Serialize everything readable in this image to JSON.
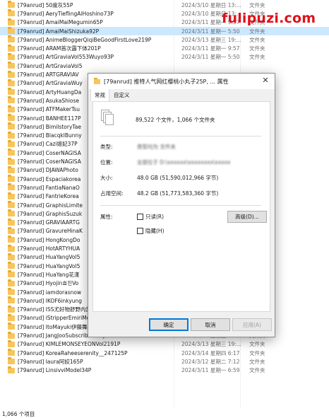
{
  "watermark": "fulipuzi.com",
  "rows": [
    {
      "name": "[79anrud] 50度灰55P",
      "date": "2024/3/10 星期日 13:...",
      "type": "文件夹"
    },
    {
      "name": "[79anrud] AeryTieflingAiHoshino73P",
      "date": "2024/3/10 星期日 13:...",
      "type": "文件夹"
    },
    {
      "name": "[79anrud] AmaiMaiMegumin65P",
      "date": "2024/3/11 星期一 9:57",
      "type": "文件夹"
    },
    {
      "name": "[79anrud] AmaiMaiShizuka92P",
      "date": "2024/3/11 星期一 5:50",
      "type": "文件夹"
    },
    {
      "name": "[79anrud] AnimeBloggerQiqiBeGoodFirstLove219P",
      "date": "2024/3/13 星期三 19:...",
      "type": "文件夹"
    },
    {
      "name": "[79anrud] ARAM首次露下体201P",
      "date": "2024/3/11 星期一 9:57",
      "type": "文件夹"
    },
    {
      "name": "[79anrud] ArtGraviaVol553Wuyo93P",
      "date": "2024/3/11 星期一 5:50",
      "type": "文件夹"
    },
    {
      "name": "[79anrud] ArtGraviaVol5",
      "date": "",
      "type": ""
    },
    {
      "name": "[79anrud] ARTGRAVIAV",
      "date": "",
      "type": ""
    },
    {
      "name": "[79anrud] ArtGraviaWuy",
      "date": "",
      "type": ""
    },
    {
      "name": "[79anrud] ArtyHuangDa",
      "date": "",
      "type": ""
    },
    {
      "name": "[79anrud] AsukaShiose",
      "date": "",
      "type": ""
    },
    {
      "name": "[79anrud] ATFMakerTsu",
      "date": "",
      "type": ""
    },
    {
      "name": "[79anrud] BANHEE117P",
      "date": "",
      "type": ""
    },
    {
      "name": "[79anrud] BimilstoryTae",
      "date": "",
      "type": ""
    },
    {
      "name": "[79anrud] BlacqklBunny",
      "date": "",
      "type": ""
    },
    {
      "name": "[79anrud] Cazi姬妃37P",
      "date": "",
      "type": ""
    },
    {
      "name": "[79anrud] CoserNAGISA",
      "date": "",
      "type": ""
    },
    {
      "name": "[79anrud] CoserNAGISA",
      "date": "",
      "type": ""
    },
    {
      "name": "[79anrud] DJAWAPhoto",
      "date": "",
      "type": ""
    },
    {
      "name": "[79anrud] Espaciakorea",
      "date": "",
      "type": ""
    },
    {
      "name": "[79anrud] FantiaNanaO",
      "date": "",
      "type": ""
    },
    {
      "name": "[79anrud] FantrieKorea",
      "date": "",
      "type": ""
    },
    {
      "name": "[79anrud] GraphisLimite",
      "date": "",
      "type": ""
    },
    {
      "name": "[79anrud] GraphisSuzuk",
      "date": "",
      "type": ""
    },
    {
      "name": "[79anrud] GRAVIAARTG",
      "date": "",
      "type": ""
    },
    {
      "name": "[79anrud] GravureHinaK",
      "date": "",
      "type": ""
    },
    {
      "name": "[79anrud] HongKongDo",
      "date": "",
      "type": ""
    },
    {
      "name": "[79anrud] HotARTYHUA",
      "date": "",
      "type": ""
    },
    {
      "name": "[79anrud] HuaYangVol5",
      "date": "",
      "type": ""
    },
    {
      "name": "[79anrud] HuaYangVol5",
      "date": "",
      "type": ""
    },
    {
      "name": "[79anrud] HuaYang花漾",
      "date": "",
      "type": ""
    },
    {
      "name": "[79anrud] Hyojin효진Vo",
      "date": "",
      "type": ""
    },
    {
      "name": "[79anrud] iamdorasnow",
      "date": "",
      "type": ""
    },
    {
      "name": "[79anrud] IKOF6inkyung",
      "date": "",
      "type": ""
    },
    {
      "name": "[79anrud] ISS尤好物舒野内部大尺度众筹145P",
      "date": "2024/3/10 星期日 13:...",
      "type": "文件夹"
    },
    {
      "name": "[79anrud] iStripperEmiriMomota204P",
      "date": "2024/3/13 星期三 7:28",
      "type": "文件夹"
    },
    {
      "name": "[79anrud] ItoMayuki伊藤舞雪145P",
      "date": "2024/3/11 星期一 9:57",
      "type": "文件夹"
    },
    {
      "name": "[79anrud] JangJooSubscriberOnly0192P",
      "date": "2024/3/13 星期三 19:...",
      "type": "文件夹"
    },
    {
      "name": "[79anrud] KIMLEMONSEYEONVol2191P",
      "date": "2024/3/13 星期三 19:...",
      "type": "文件夹"
    },
    {
      "name": "[79anrud] KoreaRaheeserenity__247125P",
      "date": "2024/3/14 星期四 6:17",
      "type": "文件夹"
    },
    {
      "name": "[79anrud] laura阿姣165P",
      "date": "2024/3/12 星期二 7:12",
      "type": "文件夹"
    },
    {
      "name": "[79anrud] LinsivviModel34P",
      "date": "2024/3/11 星期一 6:59",
      "type": "文件夹"
    }
  ],
  "status": "1,066 个项目",
  "dialog": {
    "title": "[79anrud] 推特人气网红樱桃小丸子25P, ... 属性",
    "close": "✕",
    "tabs": [
      "常规",
      "自定义"
    ],
    "summary": "89,522 个文件，1,066 个文件夹",
    "type_label": "类型:",
    "type_value": "类型均为 文件夹",
    "location_label": "位置:",
    "location_value": "全部位于 D:\\xxxxxx\\xxxxxxxx\\xxxxx",
    "size_label": "大小:",
    "size_value": "48.0 GB (51,590,012,966 字节)",
    "disk_label": "占用空间:",
    "disk_value": "48.2 GB (51,773,583,360 字节)",
    "attr_label": "属性:",
    "readonly_label": "只读(R)",
    "hidden_label": "隐藏(H)",
    "advanced_label": "高级(D)...",
    "ok_label": "确定",
    "cancel_label": "取消",
    "apply_label": "应用(A)"
  }
}
